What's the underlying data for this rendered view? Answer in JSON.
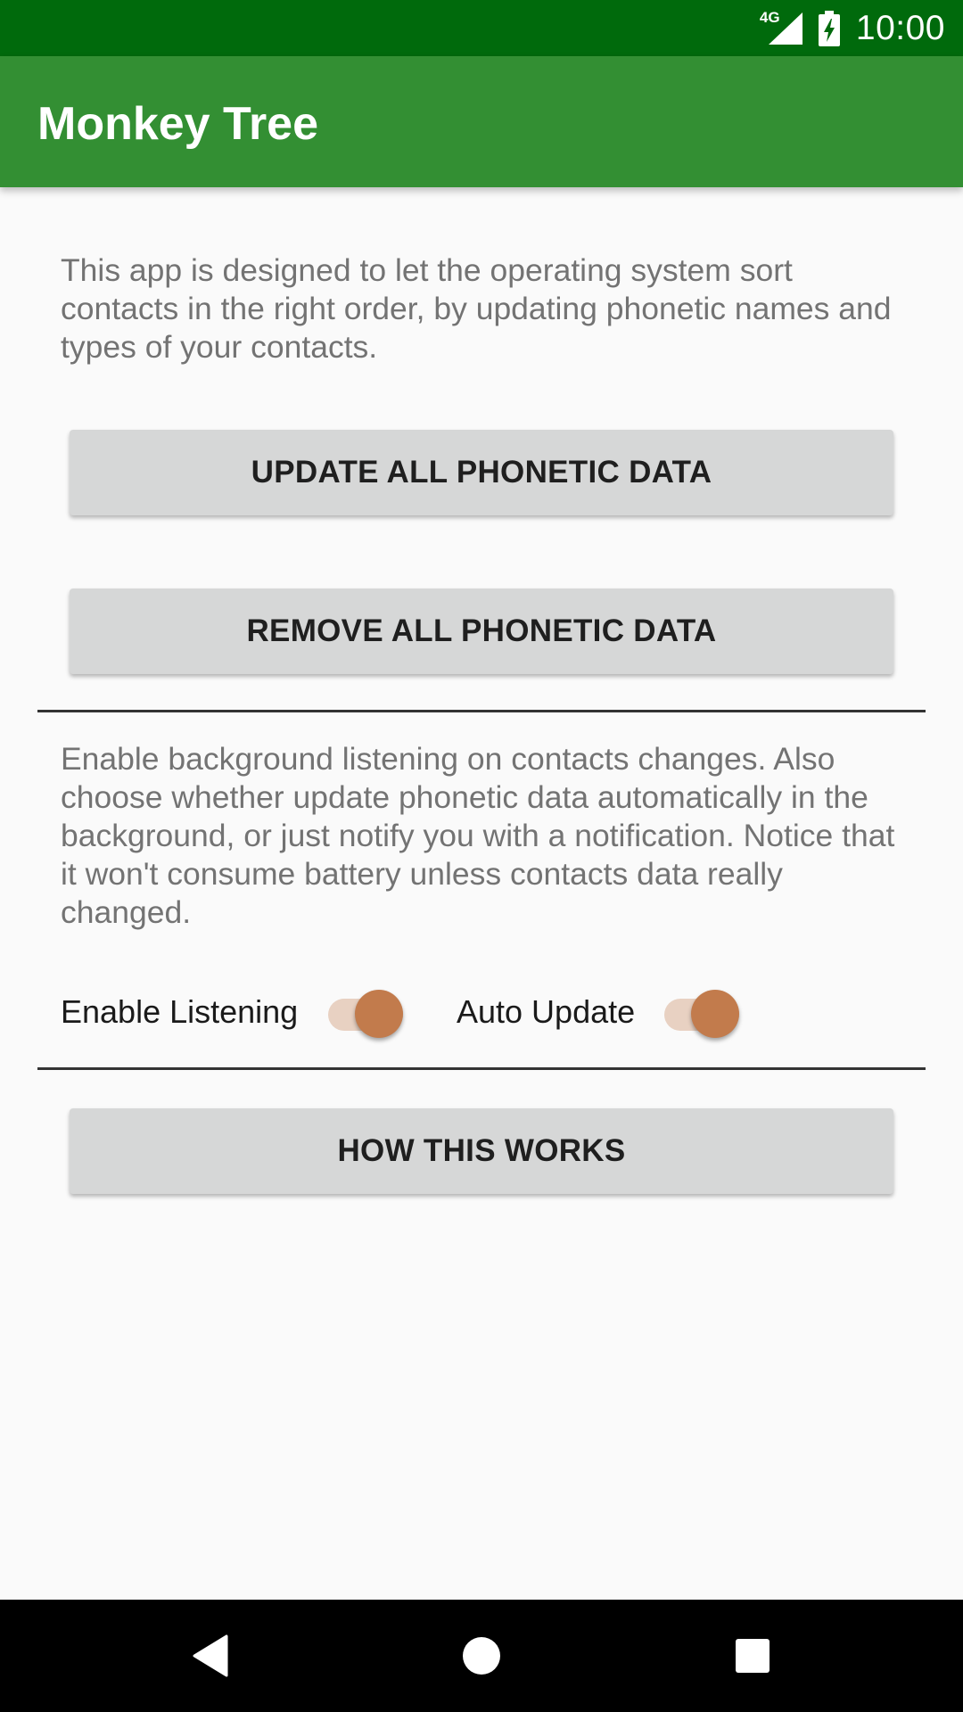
{
  "status_bar": {
    "time": "10:00",
    "network_label": "4G",
    "icons": [
      "signal-icon",
      "battery-charging-icon"
    ]
  },
  "app_bar": {
    "title": "Monkey Tree"
  },
  "main": {
    "intro_text": "This app is designed to let the operating system sort contacts in the right order, by updating phonetic names and types of your contacts.",
    "update_button_label": "UPDATE ALL PHONETIC DATA",
    "remove_button_label": "REMOVE ALL PHONETIC DATA",
    "background_text": "Enable background listening on contacts changes. Also choose whether update phonetic data automatically in the background, or just notify you with a notification. Notice that it won't consume battery unless contacts data really changed.",
    "toggles": [
      {
        "label": "Enable Listening",
        "checked": true
      },
      {
        "label": "Auto Update",
        "checked": true
      }
    ],
    "how_button_label": "HOW THIS WORKS"
  },
  "nav_bar": {
    "icons": [
      "back-icon",
      "home-icon",
      "recents-icon"
    ]
  },
  "colors": {
    "status_bar": "#006a0c",
    "app_bar": "#338f33",
    "switch_thumb": "#c27b4c",
    "switch_track": "#e8d1c2",
    "button_bg": "#d6d7d7"
  }
}
